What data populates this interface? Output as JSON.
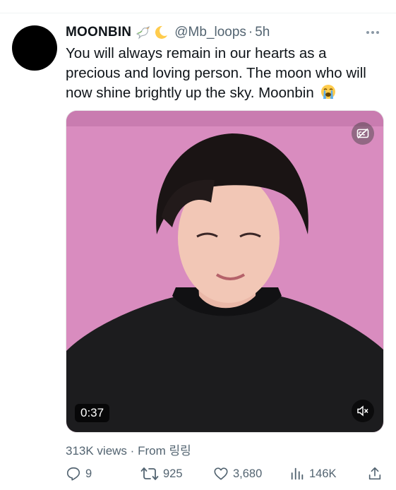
{
  "tweet": {
    "display_name": "MOONBIN",
    "name_emojis": [
      "dove-emoji",
      "crescent-moon-emoji"
    ],
    "handle": "@Mb_loops",
    "separator": "·",
    "time": "5h",
    "text": "You will always remain in our hearts as a precious and loving person. The moon who will now shine brightly up the sky. Moonbin",
    "text_emoji": "loudly-crying-face-emoji"
  },
  "video": {
    "duration": "0:37",
    "icons": [
      "captions-off-icon",
      "muted-speaker-icon"
    ],
    "background_color": "#d98cbf"
  },
  "meta": {
    "views": "313K views",
    "separator": "·",
    "from": "From 링링"
  },
  "actions": {
    "replies": "9",
    "retweets": "925",
    "likes": "3,680",
    "views": "146K"
  },
  "colors": {
    "text": "#0f1419",
    "secondary": "#536471",
    "background": "#ffffff"
  }
}
